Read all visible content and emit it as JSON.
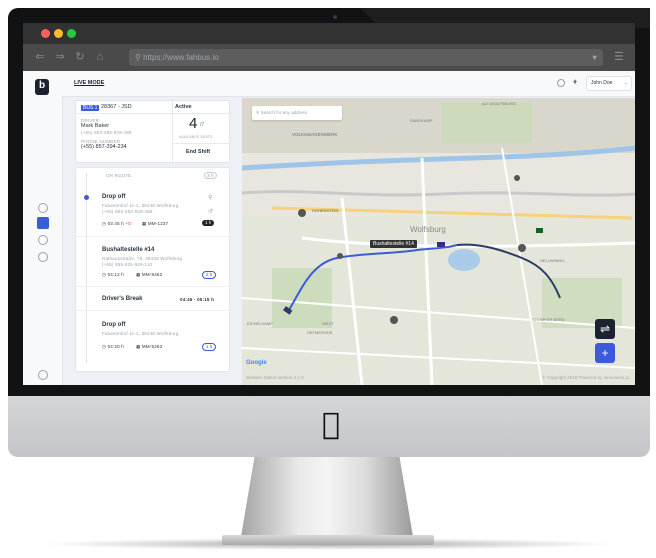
{
  "browser": {
    "url": "https://www.fahbus.io",
    "nav_icons": [
      "back-icon",
      "forward-icon",
      "reload-icon",
      "home-icon"
    ]
  },
  "header": {
    "mode_label": "LIVE MODE",
    "user_name": "John Doe"
  },
  "bus": {
    "tag": "BUS 1",
    "plate": "28367 - JSD",
    "status": "Active",
    "driver_label": "DRIVER",
    "driver_name": "Mark Baker",
    "driver_phone": "(+55) 853-283-928-465",
    "phone_label": "PHONE NUMBER",
    "phone": "(+55) 857-394-234",
    "seats": "4",
    "seats_total": "/7",
    "seats_label": "AVAILABLE SEATS",
    "end_shift": "End Shift"
  },
  "timeline": {
    "top_label": "ON ROUTE",
    "top_badge": "3 h",
    "stops": [
      {
        "title": "Drop off",
        "address": "Fasanenhof 11-1, 38446 Wolfsburg",
        "phone": "(+55) 855-283-928-465",
        "time": "03:45 h",
        "delay": "+5'",
        "code": "MM-1237",
        "badge": "1 h"
      },
      {
        "title": "Bushaltestelle #14",
        "address": "Rathausstraße, 78, 38440 Wolfsburg",
        "phone": "(+55) 855-835-928-142",
        "time": "04:12 h",
        "code": "MM-8462",
        "badge": "2 h"
      },
      {
        "title": "Driver's Break",
        "range": "04:45 - 05:15 h"
      },
      {
        "title": "Drop off",
        "address": "Fasanenhof 11-1, 38446 Wolfsburg",
        "time": "04:20 h",
        "code": "MM-5263",
        "badge": "1 h"
      }
    ]
  },
  "map": {
    "search_placeholder": "Search for any address",
    "labels": {
      "alt_wolfsburg": "ALT-WOLFSBURG",
      "vw": "VOLKSWAGENWERK",
      "sandkamp": "SANDKAMP",
      "hohenstein": "HOHENSTEIN",
      "wolfsburg": "Wolfsburg",
      "hellwinkel": "HELLWINKEL",
      "steimker": "STEIMKER BERG",
      "eichelkamp": "EICHELKAMP",
      "detmerode": "DETMERODE",
      "west": "WEST",
      "bushaltestelle": "Bushaltestelle #14",
      "google": "Google"
    },
    "route_colors": [
      "#3b5bdb",
      "#2b3a67"
    ]
  },
  "footer": {
    "left": "Website  Status  Version 2.1.0",
    "right": "© Copyright 2018  Powered by Innovaeos.io"
  },
  "colors": {
    "accent": "#3b5bdb",
    "dark": "#1b2230",
    "map_bg": "#e8e6df"
  }
}
